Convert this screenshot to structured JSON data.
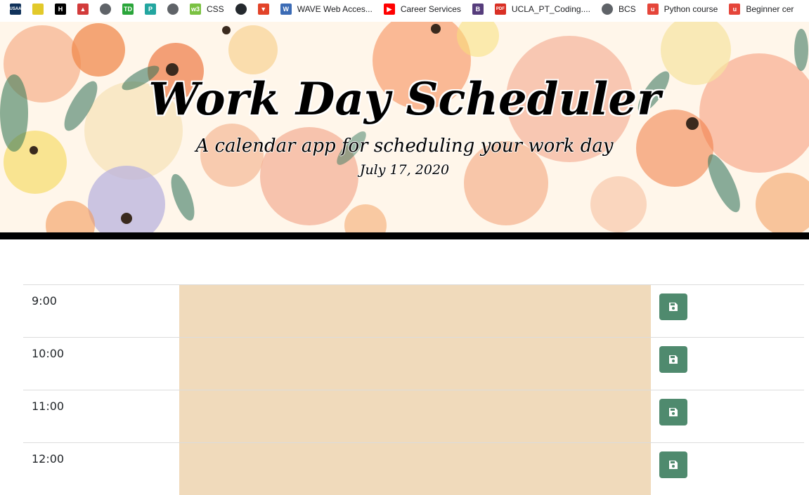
{
  "bookmarks": [
    {
      "label": "",
      "icon": "usaa-icon",
      "color": "#10325a",
      "glyph": "USAA"
    },
    {
      "label": "",
      "icon": "square-logo-icon",
      "color": "#e2c92a",
      "glyph": ""
    },
    {
      "label": "",
      "icon": "h-logo-icon",
      "color": "#000000",
      "glyph": "H"
    },
    {
      "label": "",
      "icon": "tent-logo-icon",
      "color": "#d23b3b",
      "glyph": "▲"
    },
    {
      "label": "",
      "icon": "globe-icon",
      "color": "#5f6368",
      "glyph": "●"
    },
    {
      "label": "",
      "icon": "td-logo-icon",
      "color": "#2aa53a",
      "glyph": "TD"
    },
    {
      "label": "",
      "icon": "p-logo-icon",
      "color": "#23a6a0",
      "glyph": "P"
    },
    {
      "label": "",
      "icon": "globe-icon",
      "color": "#5f6368",
      "glyph": "●"
    },
    {
      "label": "CSS",
      "icon": "css-logo-icon",
      "color": "#7ac142",
      "glyph": "w3"
    },
    {
      "label": "",
      "icon": "github-icon",
      "color": "#24292e",
      "glyph": "●"
    },
    {
      "label": "",
      "icon": "gitlab-icon",
      "color": "#e24329",
      "glyph": "▼"
    },
    {
      "label": "WAVE Web Acces...",
      "icon": "wave-icon",
      "color": "#3b6bb5",
      "glyph": "W"
    },
    {
      "label": "Career Services",
      "icon": "youtube-icon",
      "color": "#ff0000",
      "glyph": "▶"
    },
    {
      "label": "",
      "icon": "bootstrap-icon",
      "color": "#563d7c",
      "glyph": "B"
    },
    {
      "label": "UCLA_PT_Coding....",
      "icon": "pdf-icon",
      "color": "#d93025",
      "glyph": "PDF"
    },
    {
      "label": "BCS",
      "icon": "globe-icon",
      "color": "#5f6368",
      "glyph": "●"
    },
    {
      "label": "Python course",
      "icon": "udemy-icon",
      "color": "#e5453a",
      "glyph": "u"
    },
    {
      "label": "Beginner cer",
      "icon": "udemy-icon",
      "color": "#e5453a",
      "glyph": "u"
    }
  ],
  "header": {
    "title": "Work Day Scheduler",
    "subtitle": "A calendar app for scheduling your work day",
    "date": "July 17, 2020"
  },
  "schedule": {
    "rows": [
      {
        "hour": "9:00",
        "text": ""
      },
      {
        "hour": "10:00",
        "text": ""
      },
      {
        "hour": "11:00",
        "text": ""
      },
      {
        "hour": "12:00",
        "text": ""
      }
    ],
    "save_icon": "floppy-disk-icon"
  },
  "colors": {
    "present_block": "#f0dabb",
    "save_button": "#4f8a6e"
  }
}
